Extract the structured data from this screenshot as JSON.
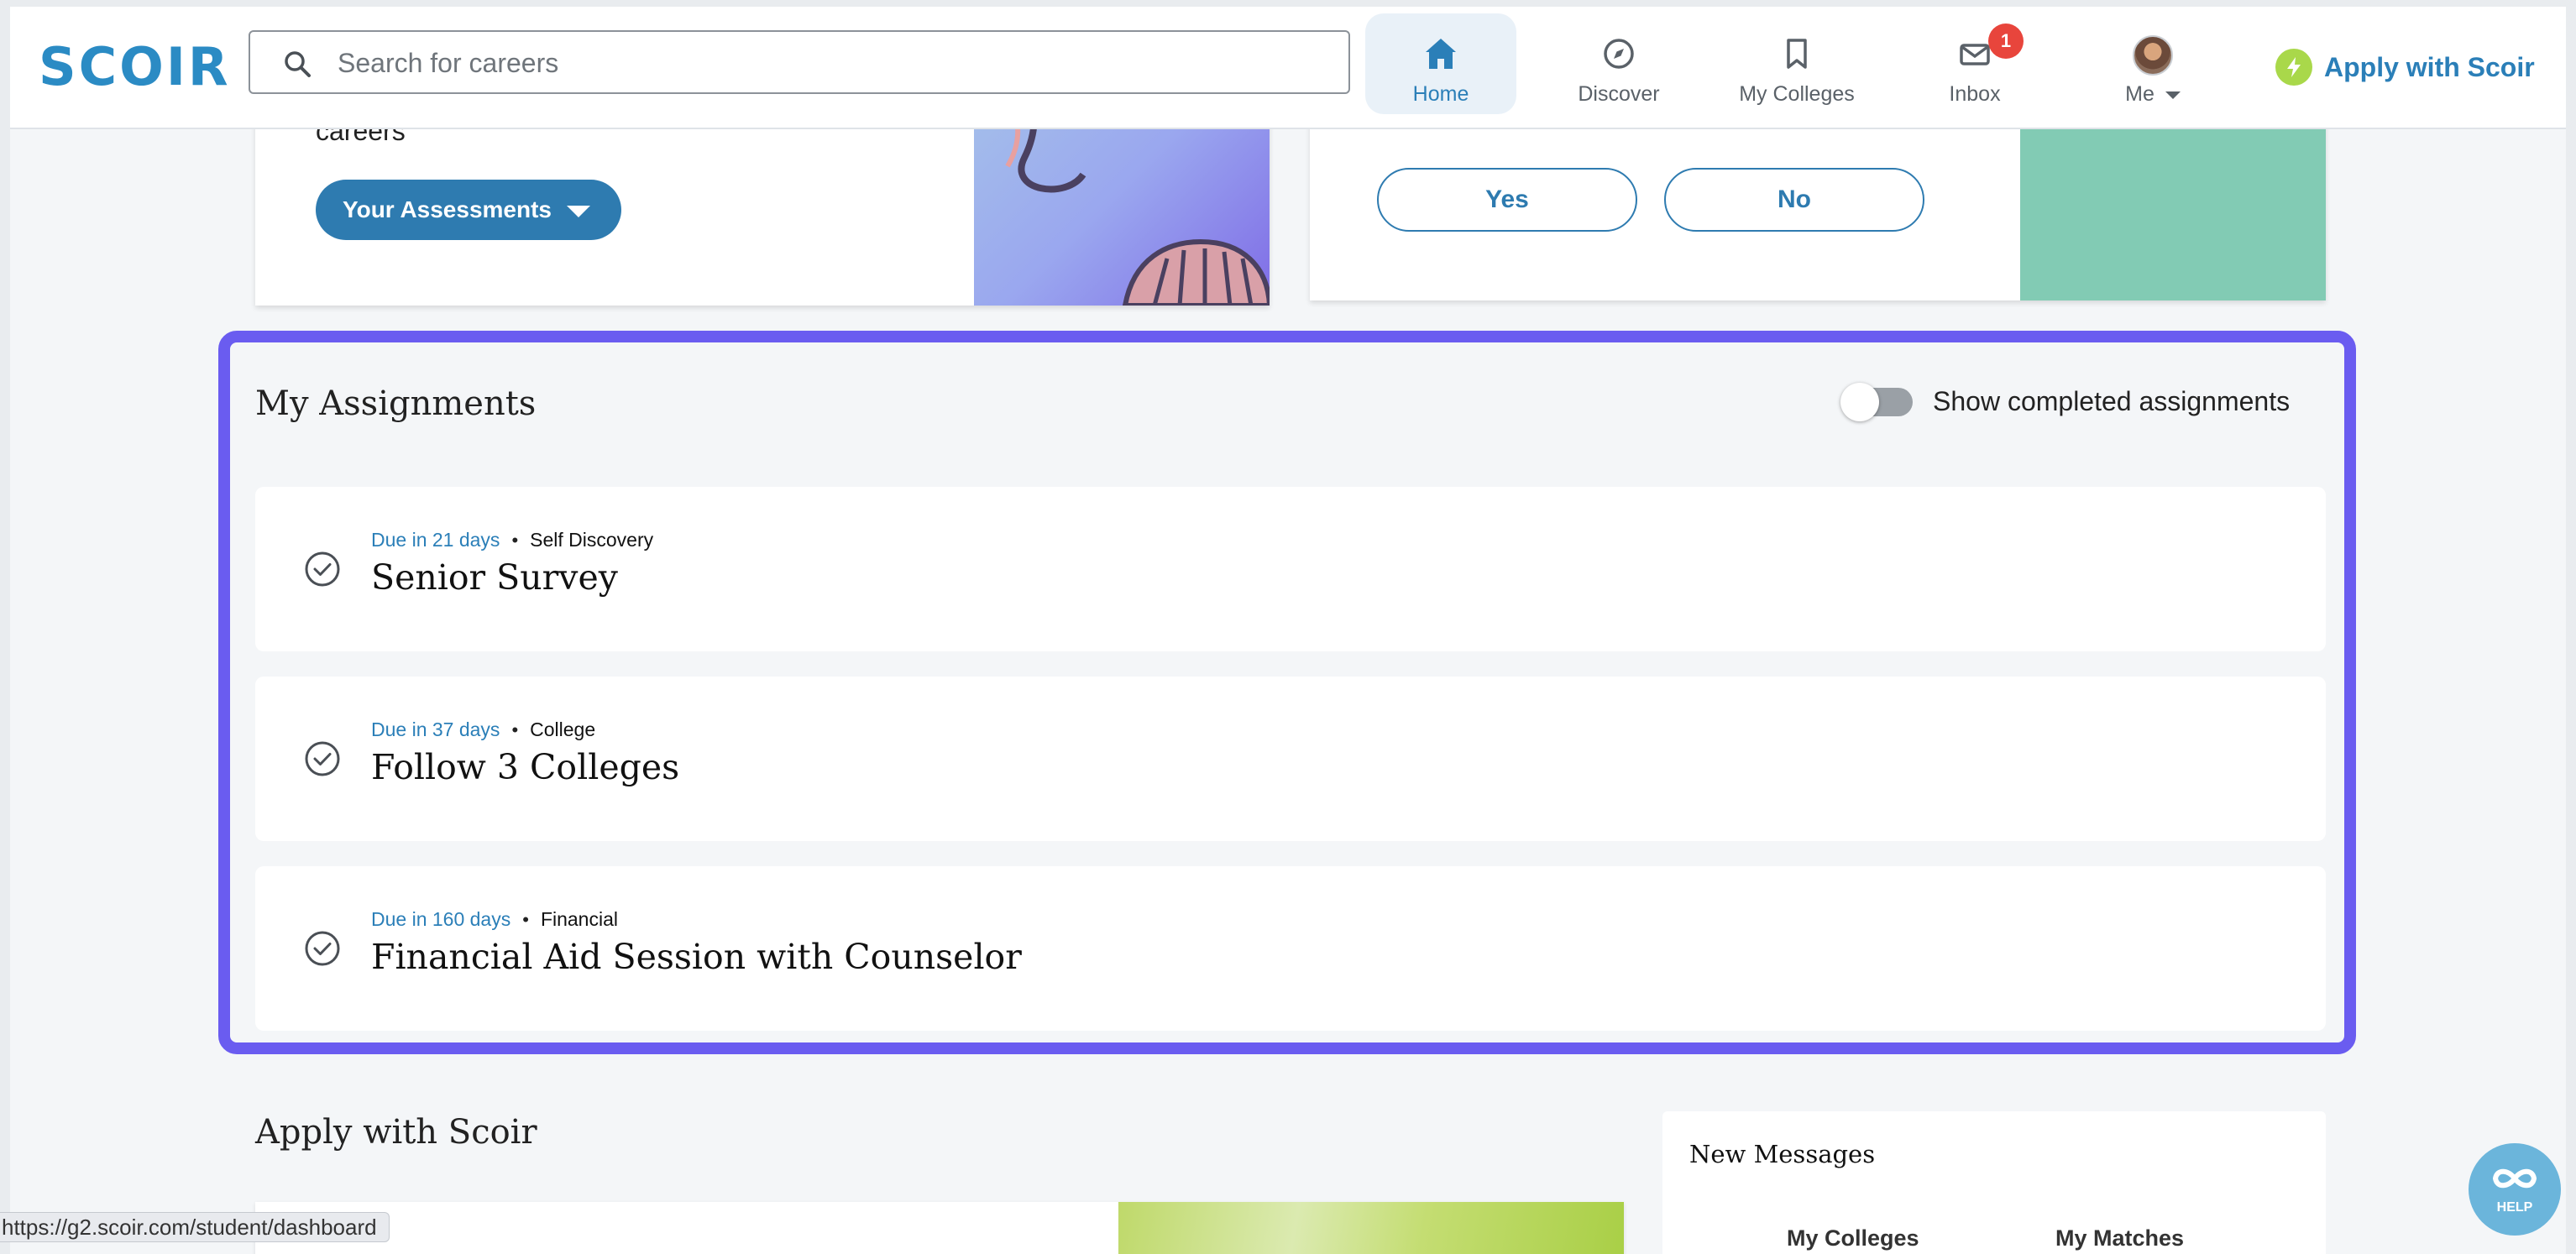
{
  "nav": {
    "logo": "SCOIR",
    "search_placeholder": "Search for careers",
    "items": [
      {
        "label": "Home",
        "icon": "home-icon",
        "active": true
      },
      {
        "label": "Discover",
        "icon": "compass-icon"
      },
      {
        "label": "My Colleges",
        "icon": "bookmark-icon"
      },
      {
        "label": "Inbox",
        "icon": "mail-icon",
        "badge": "1"
      },
      {
        "label": "Me",
        "icon": "avatar"
      }
    ],
    "apply_label": "Apply with Scoir"
  },
  "top_cards": {
    "careers_text": "careers",
    "assessments_button": "Your Assessments",
    "yes_label": "Yes",
    "no_label": "No"
  },
  "assignments": {
    "title": "My Assignments",
    "toggle_label": "Show completed assignments",
    "toggle_on": false,
    "items": [
      {
        "due": "Due in 21 days",
        "category": "Self Discovery",
        "title": "Senior Survey"
      },
      {
        "due": "Due in 37 days",
        "category": "College",
        "title": "Follow 3 Colleges"
      },
      {
        "due": "Due in 160 days",
        "category": "Financial",
        "title": "Financial Aid Session with Counselor"
      }
    ]
  },
  "apply_section": {
    "title": "Apply with Scoir"
  },
  "messages": {
    "title": "New Messages",
    "tabs": [
      "My Colleges",
      "My Matches"
    ]
  },
  "status_url": "https://g2.scoir.com/student/dashboard",
  "help_label": "HELP",
  "colors": {
    "brand": "#2b8bc4",
    "highlight": "#6a5cf0",
    "badge": "#e8453c",
    "teal": "#82cbb4"
  }
}
